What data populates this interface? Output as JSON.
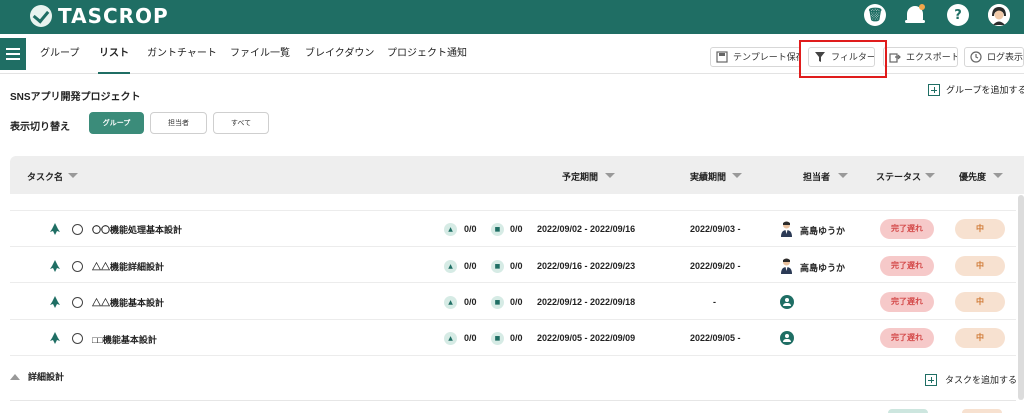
{
  "app": {
    "logo_text": "TASCROP"
  },
  "header_icons": {
    "trash": "trash-icon",
    "bell": "bell-icon",
    "help": "?",
    "avatar": "user-avatar"
  },
  "tabs": [
    {
      "label": "グループ"
    },
    {
      "label": "リスト",
      "active": true
    },
    {
      "label": "ガントチャート"
    },
    {
      "label": "ファイル一覧"
    },
    {
      "label": "ブレイクダウン"
    },
    {
      "label": "プロジェクト通知"
    }
  ],
  "toolbar": {
    "template_label": "テンプレート保存",
    "filter_label": "フィルター",
    "export_label": "エクスポート",
    "log_label": "ログ表示"
  },
  "project": {
    "title": "SNSアプリ開発プロジェクト",
    "add_group_label": "グループを追加する"
  },
  "view_switch": {
    "label": "表示切り替え",
    "options": [
      "グループ",
      "担当者",
      "すべて"
    ],
    "selected": "グループ"
  },
  "columns": {
    "task_name": "タスク名",
    "planned": "予定期間",
    "actual": "実績期間",
    "assignee": "担当者",
    "status": "ステータス",
    "priority": "優先度"
  },
  "tasks": [
    {
      "name": "〇〇機能処理基本設計",
      "sub1": "0/0",
      "sub2": "0/0",
      "planned": "2022/09/02 - 2022/09/16",
      "actual": "2022/09/03 -",
      "assignee": "高島ゆうか",
      "status": "完了遅れ",
      "priority": "中"
    },
    {
      "name": "△△機能詳細設計",
      "sub1": "0/0",
      "sub2": "0/0",
      "planned": "2022/09/16 - 2022/09/23",
      "actual": "2022/09/20 -",
      "assignee": "高島ゆうか",
      "status": "完了遅れ",
      "priority": "中"
    },
    {
      "name": "△△機能基本設計",
      "sub1": "0/0",
      "sub2": "0/0",
      "planned": "2022/09/12 - 2022/09/18",
      "actual": "-",
      "assignee": "",
      "status": "完了遅れ",
      "priority": "中"
    },
    {
      "name": "□□機能基本設計",
      "sub1": "0/0",
      "sub2": "0/0",
      "planned": "2022/09/05 - 2022/09/09",
      "actual": "2022/09/05 -",
      "assignee": "",
      "status": "完了遅れ",
      "priority": "中"
    }
  ],
  "section": {
    "title": "詳細設計",
    "add_task_label": "タスクを追加する"
  },
  "colors": {
    "brand": "#1f6e64",
    "status_bg": "#f6c9c9",
    "priority_bg": "#f7e1d0",
    "highlight": "#e01c1c"
  }
}
